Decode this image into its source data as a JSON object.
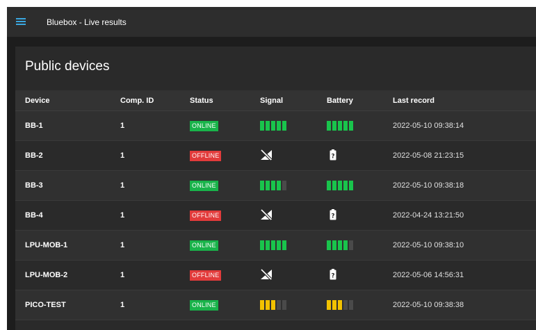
{
  "app": {
    "title": "Bluebox - Live results"
  },
  "panel": {
    "title": "Public devices"
  },
  "table": {
    "headers": {
      "device": "Device",
      "comp_id": "Comp. ID",
      "status": "Status",
      "signal": "Signal",
      "battery": "Battery",
      "last_record": "Last record"
    },
    "rows": [
      {
        "device": "BB-1",
        "comp_id": "1",
        "status": "ONLINE",
        "signal_level": 5,
        "signal_color": "green",
        "battery_level": 5,
        "battery_color": "green",
        "last_record": "2022-05-10 09:38:14"
      },
      {
        "device": "BB-2",
        "comp_id": "1",
        "status": "OFFLINE",
        "signal_level": null,
        "battery_level": null,
        "last_record": "2022-05-08 21:23:15"
      },
      {
        "device": "BB-3",
        "comp_id": "1",
        "status": "ONLINE",
        "signal_level": 4,
        "signal_color": "green",
        "battery_level": 5,
        "battery_color": "green",
        "last_record": "2022-05-10 09:38:18"
      },
      {
        "device": "BB-4",
        "comp_id": "1",
        "status": "OFFLINE",
        "signal_level": null,
        "battery_level": null,
        "last_record": "2022-04-24 13:21:50"
      },
      {
        "device": "LPU-MOB-1",
        "comp_id": "1",
        "status": "ONLINE",
        "signal_level": 5,
        "signal_color": "green",
        "battery_level": 4,
        "battery_color": "green",
        "last_record": "2022-05-10 09:38:10"
      },
      {
        "device": "LPU-MOB-2",
        "comp_id": "1",
        "status": "OFFLINE",
        "signal_level": null,
        "battery_level": null,
        "last_record": "2022-05-06 14:56:31"
      },
      {
        "device": "PICO-TEST",
        "comp_id": "1",
        "status": "ONLINE",
        "signal_level": 3,
        "signal_color": "yellow",
        "battery_level": 3,
        "battery_color": "yellow",
        "last_record": "2022-05-10 09:38:38"
      }
    ]
  },
  "colors": {
    "online": "#19b34a",
    "offline": "#e23b3b",
    "green": "#19c44c",
    "yellow": "#f2c200",
    "accent": "#3aa7e0"
  },
  "icons": {
    "menu": "hamburger-menu-icon",
    "no_signal": "no-signal-icon",
    "battery_unknown": "battery-unknown-icon"
  }
}
